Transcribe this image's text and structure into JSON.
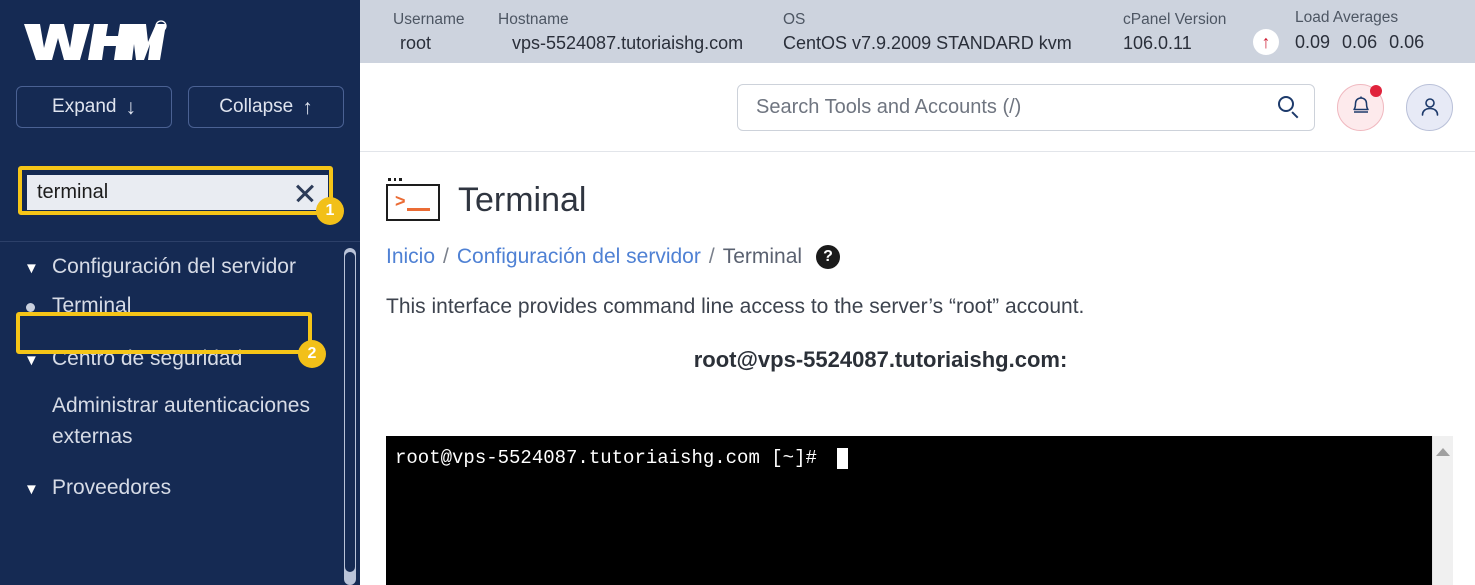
{
  "sidebar": {
    "logo_alt": "WHM",
    "expand_label": "Expand",
    "collapse_label": "Collapse",
    "search_value": "terminal",
    "clear_icon": "close-icon",
    "badges": {
      "one": "1",
      "two": "2"
    },
    "nav": [
      {
        "label": "Configuración del servidor",
        "type": "group",
        "icon": "chevron-down-icon"
      },
      {
        "label": "Terminal",
        "type": "item",
        "icon": "bullet-dot-icon",
        "selected": true
      },
      {
        "label": "Centro de seguridad",
        "type": "group",
        "icon": "chevron-down-icon"
      },
      {
        "label": "Administrar autenticaciones externas",
        "type": "item",
        "icon": ""
      },
      {
        "label": "Proveedores",
        "type": "group",
        "icon": "chevron-down-icon"
      }
    ]
  },
  "server_bar": {
    "username_label": "Username",
    "username_value": "root",
    "hostname_label": "Hostname",
    "hostname_value": "vps-5524087.tutoriaishg.com",
    "os_label": "OS",
    "os_value": "CentOS v7.9.2009 STANDARD kvm",
    "cpanel_label": "cPanel Version",
    "cpanel_value": "106.0.11",
    "load_label": "Load Averages",
    "load_arrow_icon": "arrow-up-icon",
    "load_values": [
      "0.09",
      "0.06",
      "0.06"
    ]
  },
  "topbar": {
    "search_placeholder": "Search Tools and Accounts (/)",
    "search_icon": "search-icon",
    "bell_icon": "bell-icon",
    "user_icon": "user-avatar-icon"
  },
  "page": {
    "icon": "terminal-icon",
    "title": "Terminal",
    "breadcrumb": {
      "home": "Inicio",
      "sep1": "/",
      "parent": "Configuración del servidor",
      "sep2": "/",
      "current": "Terminal",
      "help_icon": "help-icon",
      "help_glyph": "?"
    },
    "description": "This interface provides command line access to the server’s “root” account.",
    "terminal_heading": "root@vps-5524087.tutoriaishg.com:",
    "terminal_prompt": "root@vps-5524087.tutoriaishg.com [~]# ",
    "scroll_up_icon": "triangle-up-icon"
  },
  "colors": {
    "sidebar_bg": "#152a53",
    "highlight": "#f5c518",
    "badge": "#f2c019",
    "server_bar_bg": "#cdd3de",
    "link": "#4f81d4",
    "accent_orange": "#eb6c35",
    "alert_red": "#e0233c"
  }
}
